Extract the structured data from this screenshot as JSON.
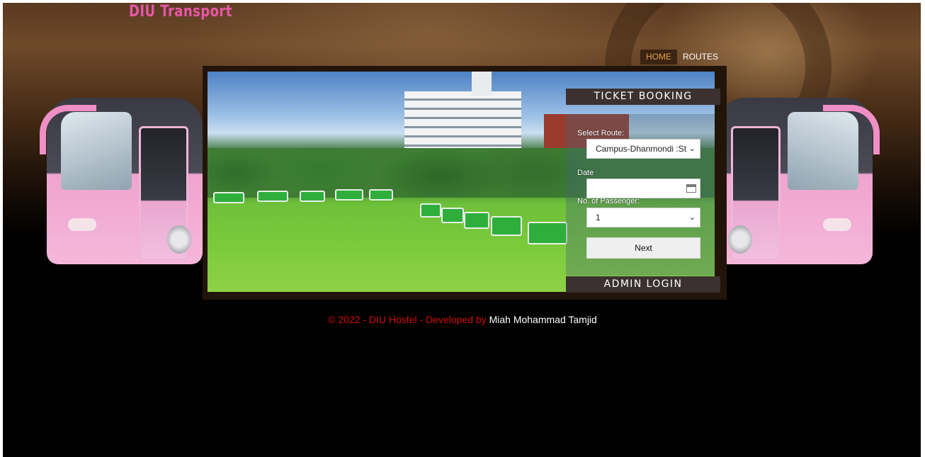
{
  "brand": {
    "title": "DIU Transport"
  },
  "nav": {
    "items": [
      {
        "label": "HOME"
      },
      {
        "label": "ROUTES"
      }
    ]
  },
  "booking": {
    "title": "TICKET BOOKING",
    "route_label": "Select Route:",
    "route_value": "Campus-Dhanmondi :St",
    "date_label": "Date",
    "date_value": "",
    "passenger_label": "No. of Passenger:",
    "passenger_value": "1",
    "next_label": "Next"
  },
  "admin": {
    "label": "ADMIN LOGIN"
  },
  "footer": {
    "prefix": "© 2022 - DIU Hostel - Developed by",
    "author": "Miah Mohammad Tamjid"
  },
  "colors": {
    "brand": "#e857a8",
    "nav_active": "#e8a04a",
    "footer_red": "#d20b0b"
  }
}
